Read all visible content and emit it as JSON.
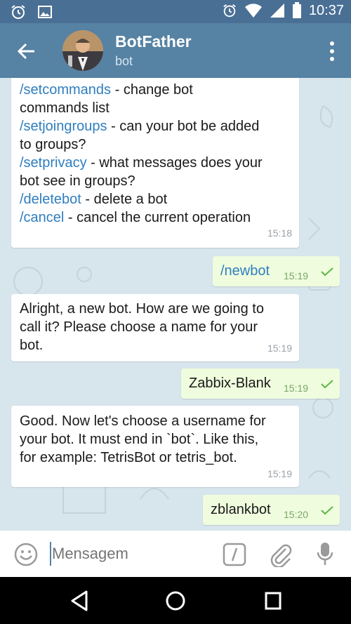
{
  "status_bar": {
    "time": "10:37",
    "icons": [
      "alarm-icon",
      "image-icon",
      "alarm-icon",
      "wifi-icon",
      "signal-icon",
      "battery-icon"
    ]
  },
  "header": {
    "title": "BotFather",
    "subtitle": "bot",
    "icons": [
      "back-arrow-icon",
      "avatar",
      "more-vert-icon"
    ]
  },
  "messages": [
    {
      "direction": "in",
      "lines": [
        {
          "cmd": "/setcommands",
          "text": " - change bot"
        },
        {
          "cmd": "",
          "text": "commands list"
        },
        {
          "cmd": "/setjoingroups",
          "text": " - can your bot be added"
        },
        {
          "cmd": "",
          "text": "to groups?"
        },
        {
          "cmd": "/setprivacy",
          "text": " - what messages does your"
        },
        {
          "cmd": "",
          "text": "bot see in groups?"
        },
        {
          "cmd": "/deletebot",
          "text": " - delete a bot"
        },
        {
          "cmd": "/cancel",
          "text": " - cancel the current operation"
        }
      ],
      "time": "15:18"
    },
    {
      "direction": "out",
      "text": "/newbot",
      "time": "15:19",
      "status": "sent"
    },
    {
      "direction": "in",
      "lines": [
        "Alright, a new bot. How are we going to",
        "call it? Please choose a name for your",
        "bot."
      ],
      "time": "15:19"
    },
    {
      "direction": "out",
      "text": "Zabbix-Blank",
      "time": "15:19",
      "status": "sent"
    },
    {
      "direction": "in",
      "lines": [
        "Good. Now let's choose a username for",
        "your bot. It must end in `bot`. Like this,",
        "for example: TetrisBot or tetris_bot."
      ],
      "time": "15:19"
    },
    {
      "direction": "out",
      "text": "zblankbot",
      "time": "15:20",
      "status": "sent"
    }
  ],
  "input": {
    "placeholder": "Mensagem",
    "icons": [
      "emoji-icon",
      "bot-command-icon",
      "attach-icon",
      "mic-icon"
    ]
  },
  "nav_bar": {
    "icons": [
      "nav-back-icon",
      "nav-home-icon",
      "nav-recents-icon"
    ]
  },
  "colors": {
    "header": "#5682a3",
    "status_bar": "#4a6f95",
    "chat_bg": "#d7e5ec",
    "out_bubble": "#effdde",
    "link": "#2f7ebf",
    "check": "#5fb54a"
  }
}
